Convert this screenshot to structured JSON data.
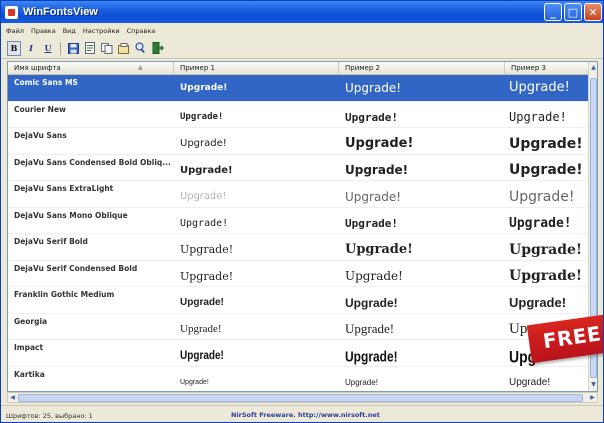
{
  "window": {
    "title": "WinFontsView",
    "controls": {
      "minimize": "_",
      "maximize": "□",
      "close": "✕"
    }
  },
  "menubar": [
    "Файл",
    "Правка",
    "Вид",
    "Настройки",
    "Справка"
  ],
  "toolbar": {
    "bold": "B",
    "italic": "I",
    "underline": "U",
    "icons": [
      "save-icon",
      "html-report-icon",
      "copy-icon",
      "properties-icon",
      "find-icon",
      "exit-icon"
    ]
  },
  "columns": [
    "Имя шрифта",
    "Пример 1",
    "Пример 2",
    "Пример 3"
  ],
  "rows": [
    {
      "name": "Comic Sans MS",
      "s1": "Upgrade!",
      "s2": "Upgrade!",
      "s3": "Upgrade!",
      "selected": true
    },
    {
      "name": "Courier New",
      "s1": "Upgrade!",
      "s2": "Upgrade!",
      "s3": "Upgrade!"
    },
    {
      "name": "DejaVu Sans",
      "s1": "Upgrade!",
      "s2": "Upgrade!",
      "s3": "Upgrade!"
    },
    {
      "name": "DejaVu Sans Condensed Bold Obliq...",
      "s1": "Upgrade!",
      "s2": "Upgrade!",
      "s3": "Upgrade!"
    },
    {
      "name": "DejaVu Sans ExtraLight",
      "s1": "Upgrade!",
      "s2": "Upgrade!",
      "s3": "Upgrade!"
    },
    {
      "name": "DejaVu Sans Mono Oblique",
      "s1": "Upgrade!",
      "s2": "Upgrade!",
      "s3": "Upgrade!"
    },
    {
      "name": "DejaVu Serif Bold",
      "s1": "Upgrade!",
      "s2": "Upgrade!",
      "s3": "Upgrade!"
    },
    {
      "name": "DejaVu Serif Condensed Bold",
      "s1": "Upgrade!",
      "s2": "Upgrade!",
      "s3": "Upgrade!"
    },
    {
      "name": "Franklin Gothic Medium",
      "s1": "Upgrade!",
      "s2": "Upgrade!",
      "s3": "Upgrade!"
    },
    {
      "name": "Georgia",
      "s1": "Upgrade!",
      "s2": "Upgrade!",
      "s3": "Up"
    },
    {
      "name": "Impact",
      "s1": "Upgrade!",
      "s2": "Upgrade!",
      "s3": "Upgi"
    },
    {
      "name": "Kartika",
      "s1": "Upgrade!",
      "s2": "Upgrade!",
      "s3": "Upgrade!"
    }
  ],
  "status": {
    "left": "Шрифтов: 25, выбрано: 1",
    "center": "NirSoft Freeware.  http://www.nirsoft.net"
  },
  "badge": {
    "text": "FREE"
  },
  "colors": {
    "selection": "#3166c6",
    "titlebar": "#0c4fd6",
    "badge": "#c8161c"
  }
}
